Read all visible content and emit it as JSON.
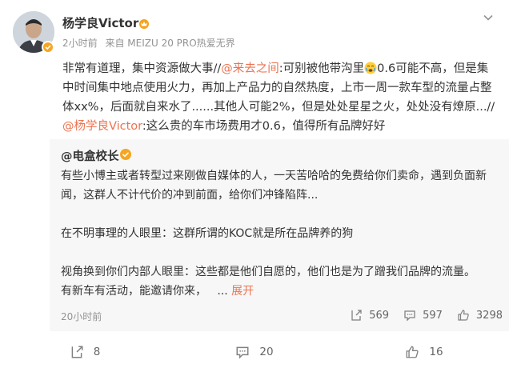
{
  "post": {
    "username": "杨学良Victor",
    "timestamp": "2小时前",
    "source": "来自 MEIZU 20 PRO热爱无界",
    "text": {
      "part1": "非常有道理，集中资源做大事//",
      "mention1": "@来去之间",
      "part2": ":可别被他带沟里",
      "part3": "0.6可能不高，但是集中时间集中地点使用火力，再加上产品力的自然热度，上市一周一款车型的流量占整体xx%，后面就自来水了......其他人可能2%，但是处处星星之火，处处没有燎原...//",
      "mention2": "@杨学良Victor",
      "part4": ":这么贵的车市场费用才0.6，值得所有品牌好好"
    }
  },
  "repost": {
    "author": "@电盒校长",
    "paragraph1": "有些小博主或者转型过来刚做自媒体的人，一天苦哈哈的免费给你们卖命，遇到负面新闻，这群人不计代价的冲到前面，给你们冲锋陷阵...",
    "paragraph2": "在不明事理的人眼里：这群所谓的KOC就是所在品牌养的狗",
    "paragraph3a": "视角换到你们内部人眼里：这些都是他们自愿的，他们也是为了蹭我们品牌的流量。",
    "paragraph3b": "有新车有活动，能邀请你来，",
    "ellipsis": "...",
    "expand": "展开",
    "timestamp": "20小时前",
    "reposts": "569",
    "comments": "597",
    "likes": "3298"
  },
  "actions": {
    "repost_count": "8",
    "comment_count": "20",
    "like_count": "16"
  },
  "colors": {
    "mention": "#eb7350",
    "meta": "#939393",
    "verify": "#f5a623",
    "repost_bg": "#f7f7f7"
  },
  "icons": {
    "avatar": "avatar",
    "verify": "verified-badge-icon",
    "crown": "crown-icon",
    "more": "chevron-down-icon",
    "emoji": "emoji-icon",
    "repost": "repost-icon",
    "comment": "comment-icon",
    "like": "like-icon"
  }
}
